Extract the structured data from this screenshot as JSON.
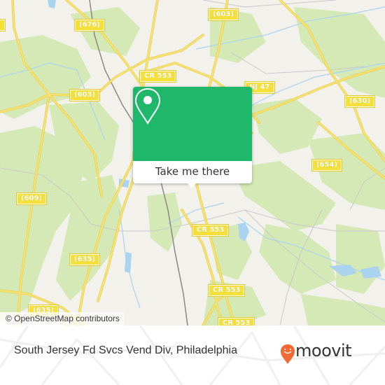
{
  "map": {
    "road_labels": [
      {
        "id": "r676",
        "text": "(676)"
      },
      {
        "id": "r603a",
        "text": "(603)"
      },
      {
        "id": "r603b",
        "text": "(603)"
      },
      {
        "id": "cr553a",
        "text": "CR 553"
      },
      {
        "id": "nj47",
        "text": "NJ 47"
      },
      {
        "id": "r630",
        "text": "(630)"
      },
      {
        "id": "r654",
        "text": "(654)"
      },
      {
        "id": "r609",
        "text": "(609)"
      },
      {
        "id": "r635a",
        "text": "(635)"
      },
      {
        "id": "r635b",
        "text": "(635)"
      },
      {
        "id": "cr553b",
        "text": "CR 553"
      },
      {
        "id": "cr553c",
        "text": "CR 553"
      },
      {
        "id": "cr553d",
        "text": "CR 553"
      }
    ],
    "attribution": "© OpenStreetMap contributors",
    "colors": {
      "land": "#f2f1ec",
      "forest": "#d4e9b5",
      "water": "#a9d3ee",
      "road": "#f7dc54",
      "rail": "#888888"
    }
  },
  "popup": {
    "button_label": "Take me there",
    "color": "#1fb86a",
    "icon": "map-pin-icon"
  },
  "footer": {
    "place_name": "South Jersey Fd Svcs Vend Div, Philadelphia",
    "brand": "moovit",
    "brand_color": "#f06a34"
  }
}
